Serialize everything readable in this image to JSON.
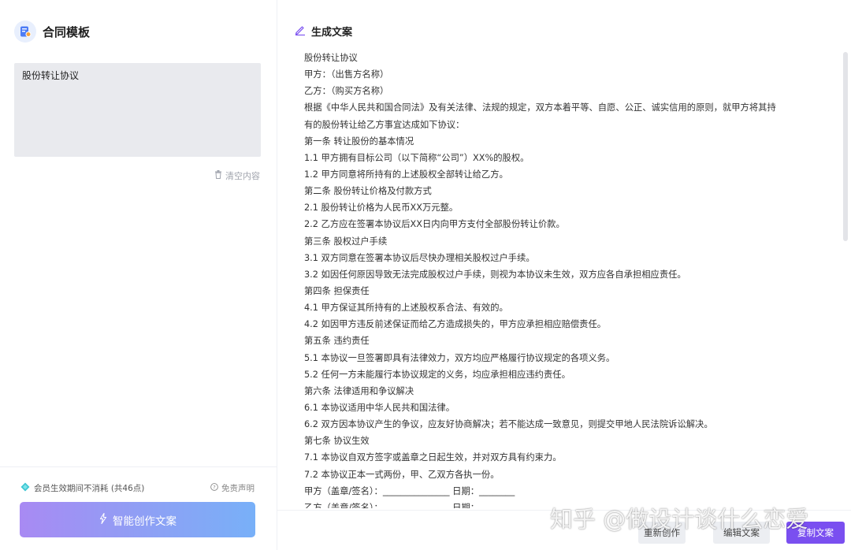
{
  "left": {
    "title": "合同模板",
    "prompt_value": "股份转让协议",
    "clear_label": "清空内容",
    "member_note": "会员生效期间不消耗 (共46点)",
    "disclaimer_label": "免责声明",
    "create_label": "智能创作文案"
  },
  "right": {
    "title": "生成文案",
    "lines": [
      "股份转让协议",
      "甲方：（出售方名称）",
      "乙方：（购买方名称）",
      "根据《中华人民共和国合同法》及有关法律、法规的规定，双方本着平等、自愿、公正、诚实信用的原则，就甲方将其持",
      "有的股份转让给乙方事宜达成如下协议：",
      "第一条 转让股份的基本情况",
      "1.1 甲方拥有目标公司（以下简称“公司”）XX%的股权。",
      "1.2 甲方同意将所持有的上述股权全部转让给乙方。",
      "第二条 股份转让价格及付款方式",
      "2.1 股份转让价格为人民币XX万元整。",
      "2.2 乙方应在签署本协议后XX日内向甲方支付全部股份转让价款。",
      "第三条 股权过户手续",
      "3.1 双方同意在签署本协议后尽快办理相关股权过户手续。",
      "3.2 如因任何原因导致无法完成股权过户手续，则视为本协议未生效，双方应各自承担相应责任。",
      "第四条 担保责任",
      "4.1 甲方保证其所持有的上述股权系合法、有效的。",
      "4.2 如因甲方违反前述保证而给乙方造成损失的，甲方应承担相应赔偿责任。",
      "第五条 违约责任",
      "5.1 本协议一旦签署即具有法律效力，双方均应严格履行协议规定的各项义务。",
      "5.2 任何一方未能履行本协议规定的义务，均应承担相应违约责任。",
      "第六条 法律适用和争议解决",
      "6.1 本协议适用中华人民共和国法律。",
      "6.2 双方因本协议产生的争议，应友好协商解决；若不能达成一致意见，则提交甲地人民法院诉讼解决。",
      "第七条 协议生效",
      "7.1 本协议自双方签字或盖章之日起生效，并对双方具有约束力。",
      "7.2 本协议正本一式两份，甲、乙双方各执一份。",
      "甲方（盖章/签名）：_______________ 日期：________",
      "乙方（盖章/签名）：_______________ 日期：________"
    ],
    "regen_label": "重新创作",
    "edit_label": "编辑文案",
    "copy_label": "复制文案"
  },
  "watermark": "知乎 @做设计谈什么恋爱",
  "colors": {
    "accent": "#7a4ff0",
    "gradient_start": "#a88af3",
    "gradient_end": "#78b0f8",
    "input_bg": "#e9eaee"
  },
  "icons": {
    "app": "template-icon",
    "clear": "trash-icon",
    "member": "diamond-icon",
    "disclaimer": "question-circle-icon",
    "create": "magic-wand-icon",
    "title": "pencil-icon"
  }
}
